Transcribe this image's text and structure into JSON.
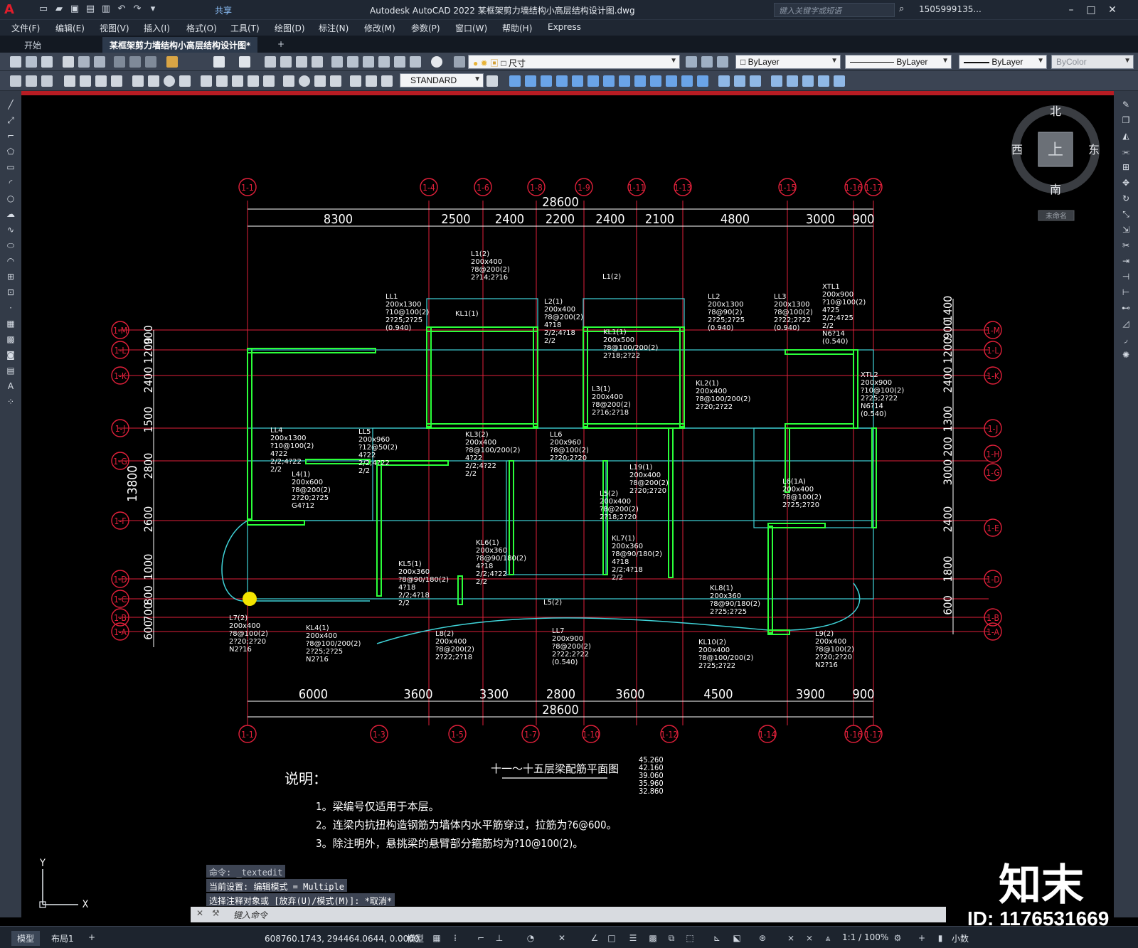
{
  "app": {
    "title": "Autodesk AutoCAD 2022    某框架剪力墙结构小高层结构设计图.dwg",
    "share": "共享",
    "search_placeholder": "键入关键字或短语",
    "user": "1505999135...",
    "logo": "A"
  },
  "menu": [
    "文件(F)",
    "编辑(E)",
    "视图(V)",
    "插入(I)",
    "格式(O)",
    "工具(T)",
    "绘图(D)",
    "标注(N)",
    "修改(M)",
    "参数(P)",
    "窗口(W)",
    "帮助(H)",
    "Express"
  ],
  "tabs": [
    "开始",
    "某框架剪力墙结构小高层结构设计图*",
    "+"
  ],
  "toolbar": {
    "layer": "尺寸",
    "color": "ByLayer",
    "linetype": "ByLayer",
    "lineweight": "ByLayer",
    "plotstyle": "ByColor",
    "textstyle": "STANDARD"
  },
  "viewcube": {
    "north": "北",
    "south": "南",
    "east": "东",
    "west": "西",
    "top": "上",
    "wcs": "未命名"
  },
  "ucs": {
    "x": "X",
    "y": "Y"
  },
  "drawing": {
    "title": "十一～十五层梁配筋平面图",
    "total_dim": "28600",
    "top_dims": [
      "8300",
      "2500",
      "2400",
      "2200",
      "2400",
      "2100",
      "4800",
      "3000",
      "900"
    ],
    "bottom_dims": [
      "6000",
      "3600",
      "3300",
      "2800",
      "3600",
      "4500",
      "3900",
      "900"
    ],
    "left_dims": [
      "900",
      "1200",
      "2400",
      "1500",
      "2800",
      "2600",
      "1000",
      "800",
      "700",
      "600"
    ],
    "left_total": "13800",
    "right_dims": [
      "1400",
      "900",
      "1200",
      "2400",
      "1300",
      "200",
      "3000",
      "2400",
      "1800",
      "600"
    ],
    "top_axes": [
      "1-1",
      "1-4",
      "1-6",
      "1-8",
      "1-9",
      "1-11",
      "1-13",
      "1-15",
      "1-16",
      "1-17"
    ],
    "bottom_axes": [
      "1-1",
      "1-3",
      "1-5",
      "1-7",
      "1-10",
      "1-12",
      "1-14",
      "1-16",
      "1-17"
    ],
    "left_axes": [
      "1-M",
      "1-L",
      "1-K",
      "1-J",
      "1-G",
      "1-F",
      "1-D",
      "1-C",
      "1-B",
      "1-A"
    ],
    "right_axes": [
      "1-M",
      "1-L",
      "1-K",
      "1-J",
      "1-H",
      "1-G",
      "1-E",
      "1-D",
      "1-B",
      "1-A"
    ],
    "elevations": [
      "45.260",
      "42.160",
      "39.060",
      "35.960",
      "32.860"
    ],
    "notes_title": "说明：",
    "notes": [
      "1。梁编号仅适用于本层。",
      "2。连梁内抗扭构造钢筋为墙体内水平筋穿过，拉筋为?6@600。",
      "3。除注明外，悬挑梁的悬臂部分箍筋均为?10@100(2)。"
    ],
    "beam_labels": [
      "LL1 200x1300 ?10@100(2) 2?25;2?25 (0.940)",
      "L1(2) 200x400 ?8@200(2) 2?14;2?16",
      "KL1(1)",
      "L2(1) 200x400 ?8@200(2) 4?18 2/2;4?18 2/2",
      "L1(2)",
      "LL2 200x1300 ?8@90(2) 2?25;2?25 (0.940)",
      "LL3 200x1300 ?8@100(2) 2?22;2?22 (0.940)",
      "XTL1 200x900 ?10@100(2) 4?25 2/2;4?25 2/2 N6?14 (0.540)",
      "KL1(1) 200x500 ?8@100/200(2) 2?18;2?22",
      "L3(1) 200x400 ?8@200(2) 2?16;2?18",
      "KL2(1) 200x400 ?8@100/200(2) 2?20;2?22",
      "XTL2 200x900 ?10@100(2) 2?25;2?22 N6?14 (0.540)",
      "LL4 200x1300 ?10@100(2) 4?22 2/2;4?22 2/2",
      "LL5 200x960 ?12@50(2) 4?22 2/2;4?22 2/2",
      "KL3(2) 200x400 ?8@100/200(2) 4?22 2/2;4?22 2/2",
      "LL6 200x960 ?8@100(2) 2?20;2?20",
      "L4(1) 200x600 ?8@200(2) 2?20;2?25 G4?12",
      "L19(1) 200x400 ?8@200(2) 2?20;2?20",
      "L6(1A) 200x400 ?8@100(2) 2?25;2?20",
      "L5(2) 200x400 ?8@200(2) 2?18;2?20",
      "KL6(1) 200x360 ?8@90/180(2) 4?18 2/2;4?22 2/2",
      "KL7(1) 200x360 ?8@90/180(2) 4?18 2/2;4?18 2/2",
      "KL5(1) 200x360 ?8@90/180(2) 4?18 2/2;4?18 2/2",
      "KL8(1) 200x360 ?8@90/180(2) 2?25;2?25",
      "L5(2)",
      "L7(2) 200x400 ?8@100(2) 2?20;2?20 N2?16",
      "KL4(1) 200x400 ?8@100/200(2) 2?25;2?25 N2?16",
      "L8(2) 200x400 ?8@200(2) 2?22;2?18",
      "LL7 200x900 ?8@200(2) 2?22;2?22 (0.540)",
      "KL10(2) 200x400 ?8@100/200(2) 2?25;2?22",
      "L9(2) 200x400 ?8@100(2) 2?20;2?20 N2?16"
    ]
  },
  "command": {
    "history": [
      "命令: _textedit",
      "当前设置: 编辑模式 = Multiple",
      "选择注释对象或 [放弃(U)/模式(M)]: *取消*"
    ],
    "placeholder": "键入命令"
  },
  "status": {
    "tabs": [
      "模型",
      "布局1",
      "+"
    ],
    "coords": "608760.1743, 294464.0644, 0.0000",
    "mode": "模型",
    "scale": "1:1 / 100%",
    "units": "小数"
  },
  "watermark": {
    "logo": "知末",
    "id": "ID: 1176531669"
  },
  "colors": {
    "accent": "#e21d2b",
    "axis": "#e0203a",
    "wall": "#2bff3a",
    "beam": "#3fd3d8",
    "text": "#ffffff"
  }
}
